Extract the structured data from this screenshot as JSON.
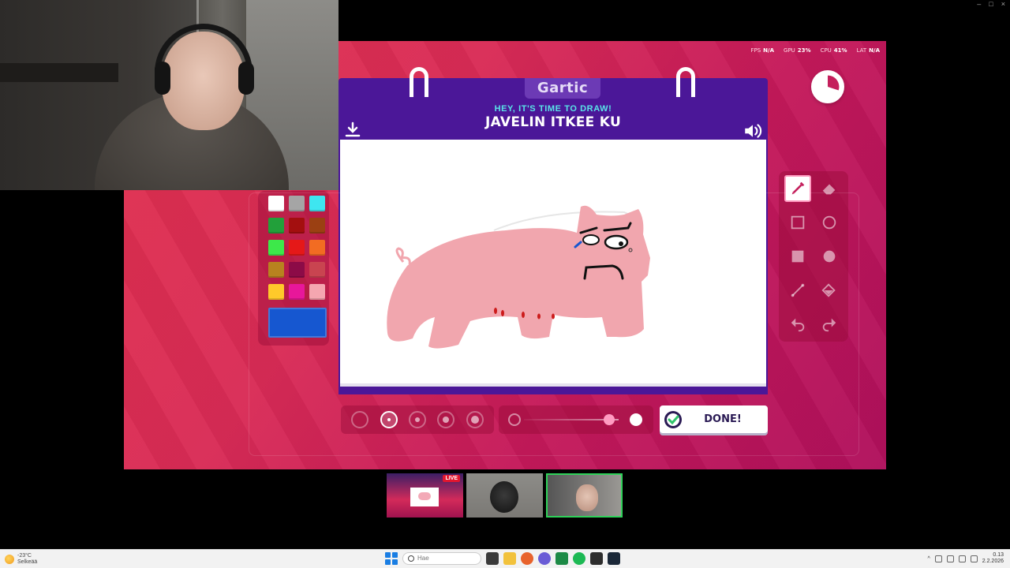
{
  "window": {
    "controls": [
      "–",
      "□",
      "×"
    ]
  },
  "stats": [
    {
      "label": "FPS",
      "value": "N/A"
    },
    {
      "label": "GPU",
      "value": "23%"
    },
    {
      "label": "CPU",
      "value": "41%"
    },
    {
      "label": "LAT",
      "value": "N/A"
    }
  ],
  "header": {
    "brand": "Gartic",
    "subtitle": "HEY, IT'S TIME TO DRAW!",
    "prompt": "JAVELIN ITKEE KU"
  },
  "timer": {
    "remaining_fraction": 0.3
  },
  "palette": {
    "colors": [
      "#ffffff",
      "#a5a5a5",
      "#3ee6f0",
      "#22a03a",
      "#a30f0f",
      "#9b4012",
      "#3de84a",
      "#e51818",
      "#f26c22",
      "#b8821f",
      "#8c0b47",
      "#c94450",
      "#ffc92a",
      "#e8179a",
      "#f5a6b0"
    ],
    "current_color": "#1657d0"
  },
  "tools": [
    "pencil-icon",
    "eraser-icon",
    "rect-outline-icon",
    "circle-outline-icon",
    "rect-filled-icon",
    "circle-filled-icon",
    "line-icon",
    "fill-bucket-icon",
    "undo-icon",
    "redo-icon"
  ],
  "active_tool": "pencil",
  "brush_sizes": {
    "count": 5,
    "selected_index": 1
  },
  "opacity": {
    "value_fraction": 0.9
  },
  "done_button": {
    "label": "DONE!"
  },
  "participants": [
    {
      "name": "stream-preview",
      "badge": "LIVE"
    },
    {
      "name": "player-2"
    },
    {
      "name": "player-3"
    }
  ],
  "taskbar": {
    "weather_temp": "-23°C",
    "weather_text": "Selkeää",
    "search_placeholder": "Hae",
    "time": "0.13",
    "date": "2.2.2026"
  }
}
